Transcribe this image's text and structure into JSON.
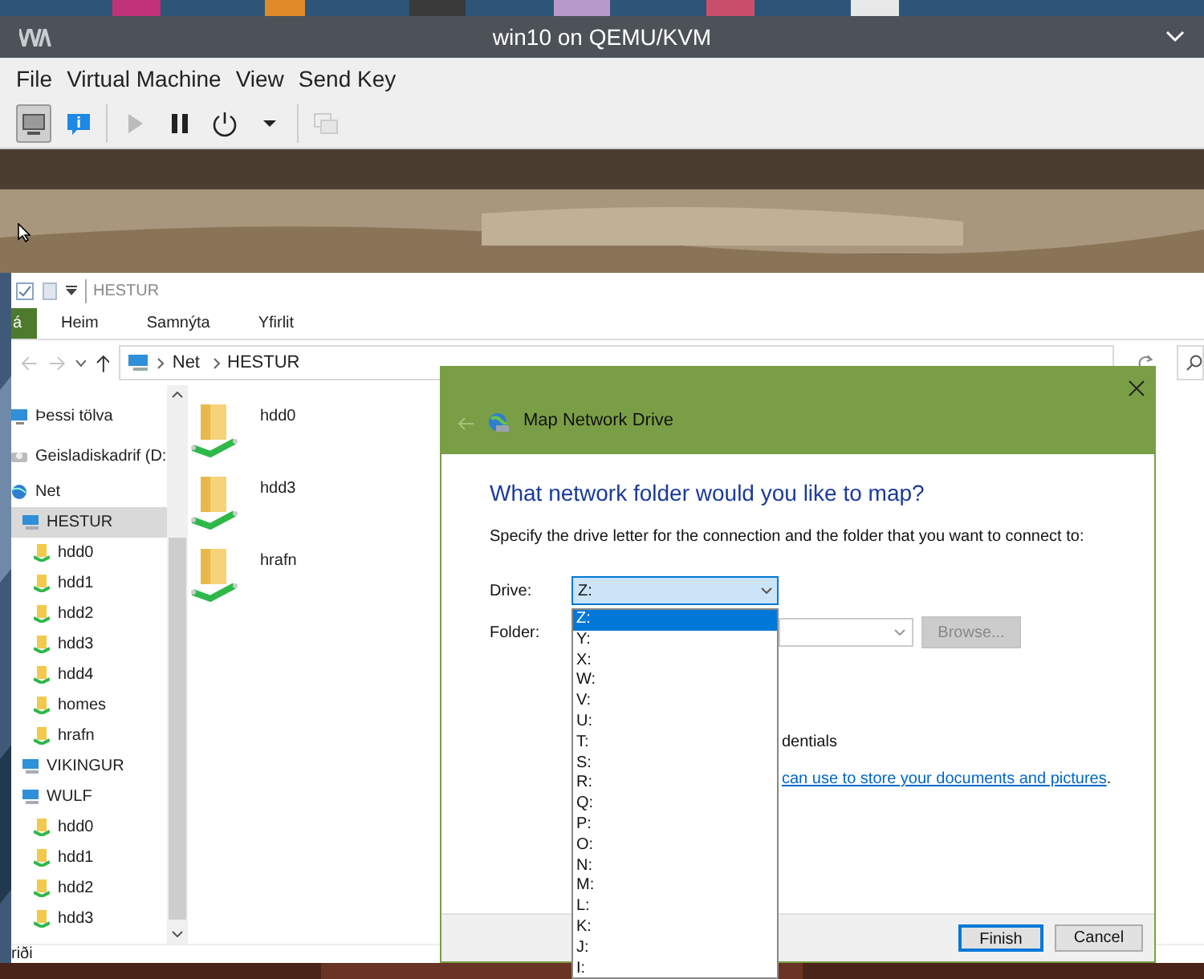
{
  "window": {
    "title": "win10 on QEMU/KVM"
  },
  "menu": [
    "File",
    "Virtual Machine",
    "View",
    "Send Key"
  ],
  "toolbar": [
    {
      "kind": "console",
      "selected": true,
      "disabled": false
    },
    {
      "kind": "details",
      "selected": false,
      "disabled": false
    },
    {
      "kind": "run",
      "selected": false,
      "disabled": true
    },
    {
      "kind": "pause",
      "selected": false,
      "disabled": false
    },
    {
      "kind": "shutdown",
      "selected": false,
      "disabled": false
    },
    {
      "kind": "shutdown_menu",
      "selected": false,
      "disabled": false
    },
    {
      "kind": "screens",
      "selected": false,
      "disabled": true
    }
  ],
  "explorer": {
    "title": "HESTUR",
    "ribbon_tabs": [
      {
        "kind": "file",
        "label": "á"
      },
      {
        "kind": "tab",
        "label": "Heim"
      },
      {
        "kind": "tab",
        "label": "Samnýta"
      },
      {
        "kind": "tab",
        "label": "Yfirlit"
      }
    ],
    "address": [
      "Net",
      "HESTUR"
    ],
    "nav": [
      {
        "label": "Þessi tölva",
        "kind": "pc",
        "selected": false
      },
      {
        "label": "Geisladiskadrif (D:",
        "kind": "disc",
        "selected": false
      },
      {
        "label": "Net",
        "kind": "network",
        "selected": false,
        "children": [
          {
            "label": "HESTUR",
            "kind": "server",
            "selected": true,
            "children": [
              {
                "label": "hdd0",
                "kind": "share",
                "selected": false
              },
              {
                "label": "hdd1",
                "kind": "share",
                "selected": false
              },
              {
                "label": "hdd2",
                "kind": "share",
                "selected": false
              },
              {
                "label": "hdd3",
                "kind": "share",
                "selected": false
              },
              {
                "label": "hdd4",
                "kind": "share",
                "selected": false
              },
              {
                "label": "homes",
                "kind": "share",
                "selected": false
              },
              {
                "label": "hrafn",
                "kind": "share",
                "selected": false
              }
            ]
          },
          {
            "label": "VIKINGUR",
            "kind": "server",
            "selected": false
          },
          {
            "label": "WULF",
            "kind": "server",
            "selected": false,
            "children": [
              {
                "label": "hdd0",
                "kind": "share",
                "selected": false
              },
              {
                "label": "hdd1",
                "kind": "share",
                "selected": false
              },
              {
                "label": "hdd2",
                "kind": "share",
                "selected": false
              },
              {
                "label": "hdd3",
                "kind": "share",
                "selected": false
              }
            ]
          }
        ]
      }
    ],
    "items": [
      {
        "name": "hdd0"
      },
      {
        "name": "hdd3"
      },
      {
        "name": "hrafn"
      }
    ],
    "status": "riði"
  },
  "dialog": {
    "title": "Map Network Drive",
    "heading": "What network folder would you like to map?",
    "description": "Specify the drive letter for the connection and the folder that you want to connect to:",
    "drive_label": "Drive:",
    "drive_value": "Z:",
    "folder_label": "Folder:",
    "browse_button": {
      "label": "Browse...",
      "disabled": true
    },
    "credentials_text": "dentials",
    "link_text": "can use to store your documents and pictures",
    "link_after": ".",
    "drive_options": [
      {
        "label": "Z:",
        "selected": true
      },
      {
        "label": "Y:",
        "selected": false
      },
      {
        "label": "X:",
        "selected": false
      },
      {
        "label": "W:",
        "selected": false
      },
      {
        "label": "V:",
        "selected": false
      },
      {
        "label": "U:",
        "selected": false
      },
      {
        "label": "T:",
        "selected": false
      },
      {
        "label": "S:",
        "selected": false
      },
      {
        "label": "R:",
        "selected": false
      },
      {
        "label": "Q:",
        "selected": false
      },
      {
        "label": "P:",
        "selected": false
      },
      {
        "label": "O:",
        "selected": false
      },
      {
        "label": "N:",
        "selected": false
      },
      {
        "label": "M:",
        "selected": false
      },
      {
        "label": "L:",
        "selected": false
      },
      {
        "label": "K:",
        "selected": false
      },
      {
        "label": "J:",
        "selected": false
      },
      {
        "label": "I:",
        "selected": false
      }
    ],
    "buttons": [
      {
        "label": "Finish",
        "default": true
      },
      {
        "label": "Cancel",
        "default": false
      }
    ]
  }
}
